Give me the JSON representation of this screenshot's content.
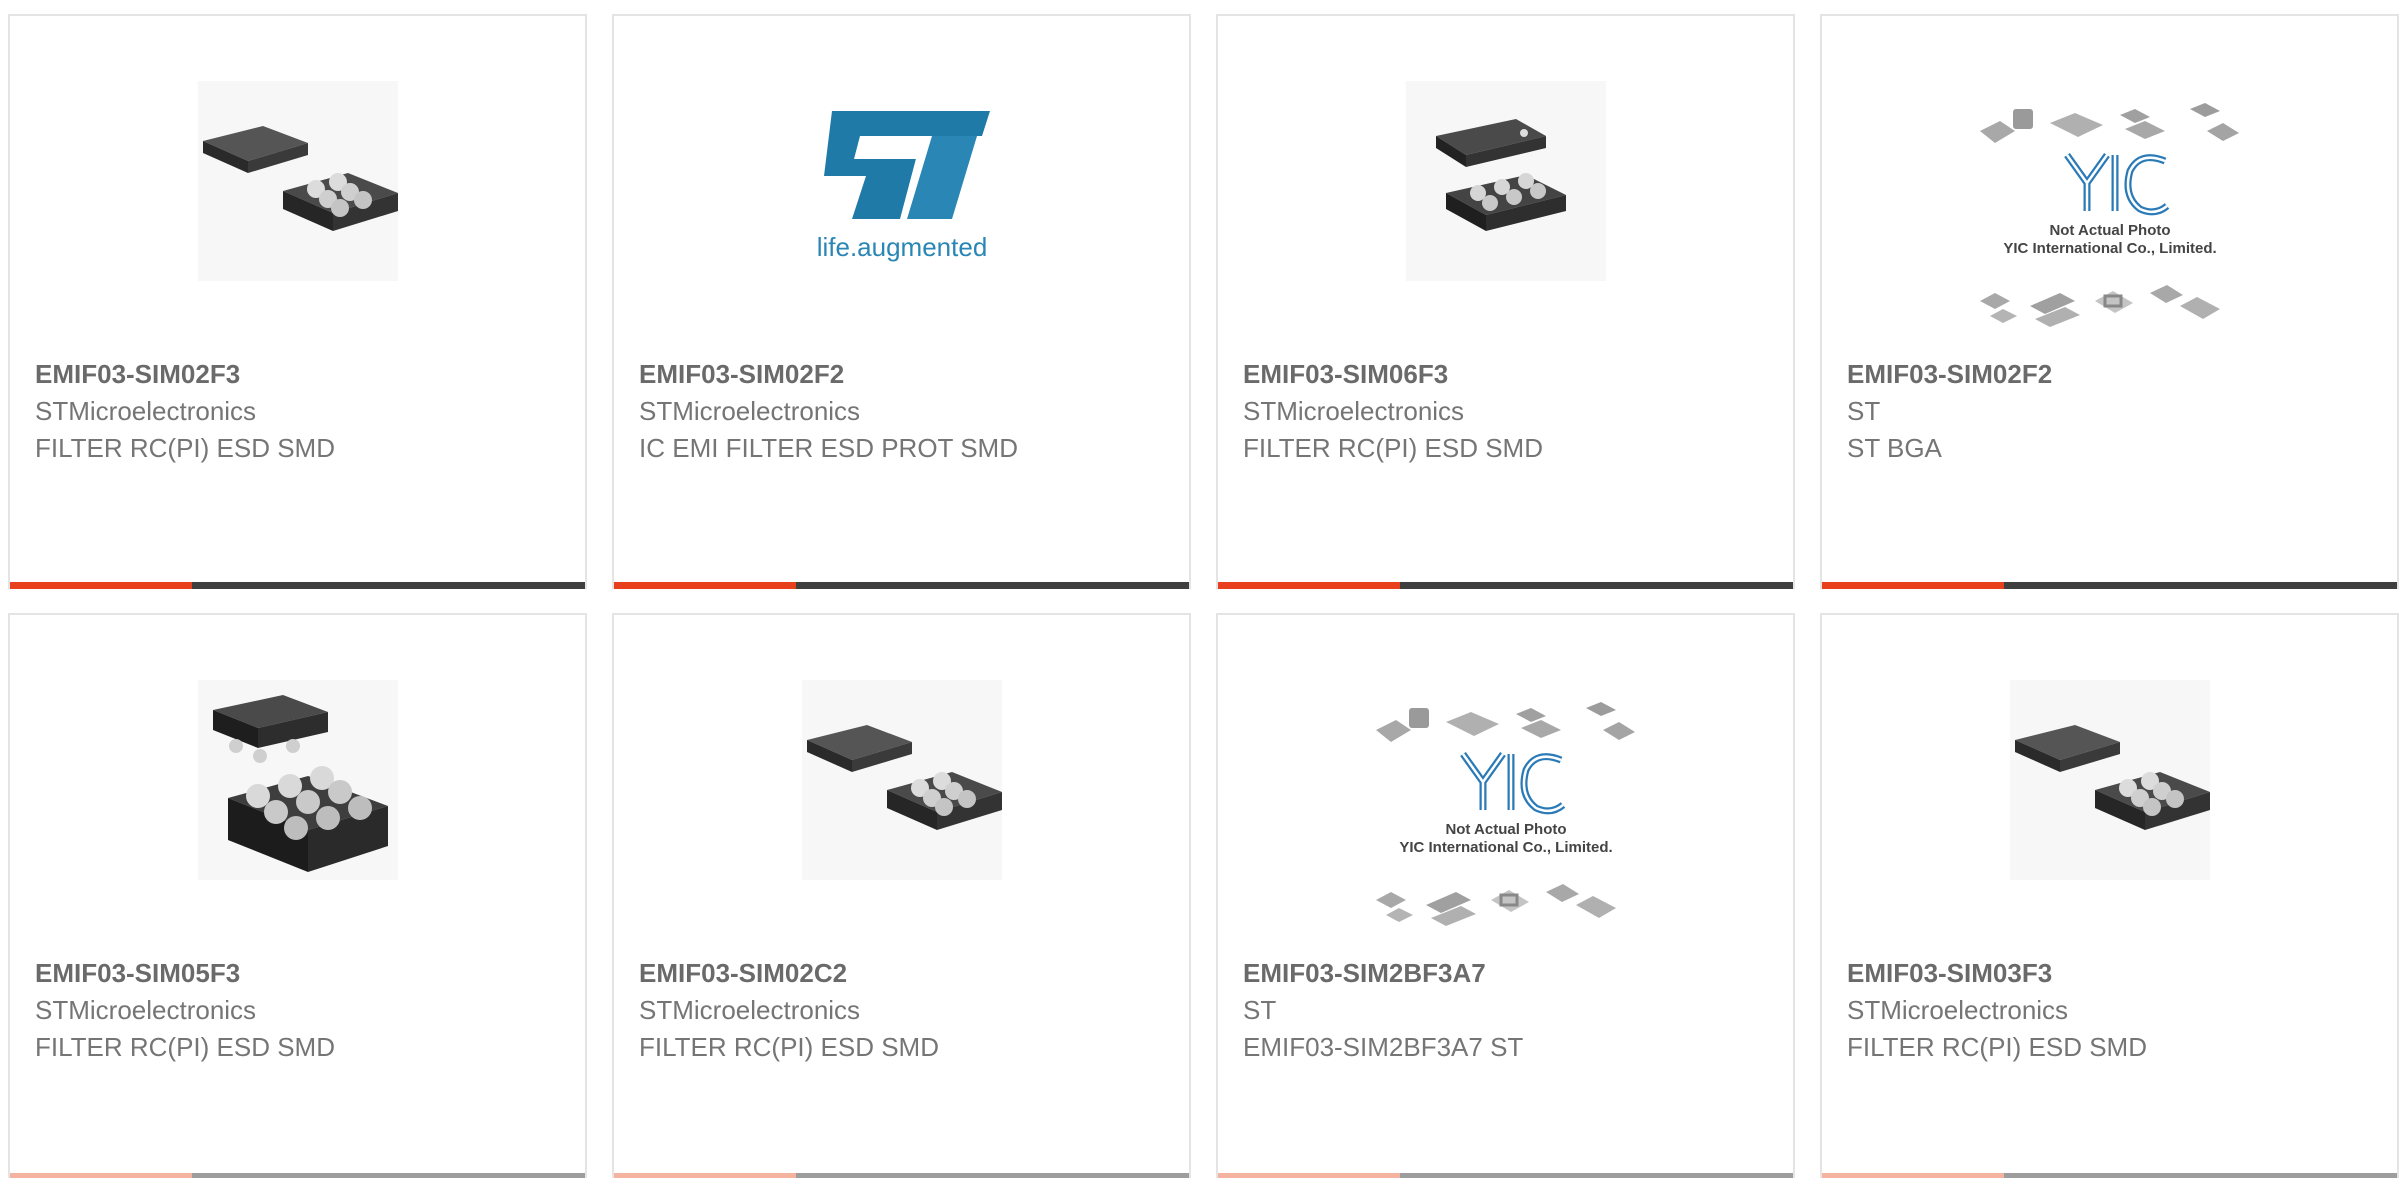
{
  "colors": {
    "accent": "#e8401c",
    "bar_dark": "#3f3f3f",
    "text_title": "#6a6a6a",
    "text_body": "#757575",
    "card_border": "#e4e4e4",
    "st_logo_blue": "#1f7aa8"
  },
  "products": [
    {
      "part_number": "EMIF03-SIM02F3",
      "manufacturer": "STMicroelectronics",
      "description": "FILTER RC(PI) ESD SMD",
      "image": "chip-pair-icon"
    },
    {
      "part_number": "EMIF03-SIM02F2",
      "manufacturer": "STMicroelectronics",
      "description": "IC EMI FILTER ESD PROT SMD",
      "image": "st-logo",
      "logo_tagline": "life.augmented"
    },
    {
      "part_number": "EMIF03-SIM06F3",
      "manufacturer": "STMicroelectronics",
      "description": "FILTER RC(PI) ESD SMD",
      "image": "chip-stacked-icon"
    },
    {
      "part_number": "EMIF03-SIM02F2",
      "manufacturer": "ST",
      "description": "ST BGA",
      "image": "yic-placeholder",
      "placeholder_line1": "Not Actual Photo",
      "placeholder_line2": "YIC International Co., Limited."
    },
    {
      "part_number": "EMIF03-SIM05F3",
      "manufacturer": "STMicroelectronics",
      "description": "FILTER RC(PI) ESD SMD",
      "image": "chip-stacked-large-icon"
    },
    {
      "part_number": "EMIF03-SIM02C2",
      "manufacturer": "STMicroelectronics",
      "description": "FILTER RC(PI) ESD SMD",
      "image": "chip-pair-icon"
    },
    {
      "part_number": "EMIF03-SIM2BF3A7",
      "manufacturer": "ST",
      "description": "EMIF03-SIM2BF3A7 ST",
      "image": "yic-placeholder",
      "placeholder_line1": "Not Actual Photo",
      "placeholder_line2": "YIC International Co., Limited."
    },
    {
      "part_number": "EMIF03-SIM03F3",
      "manufacturer": "STMicroelectronics",
      "description": "FILTER RC(PI) ESD SMD",
      "image": "chip-pair-icon"
    }
  ]
}
